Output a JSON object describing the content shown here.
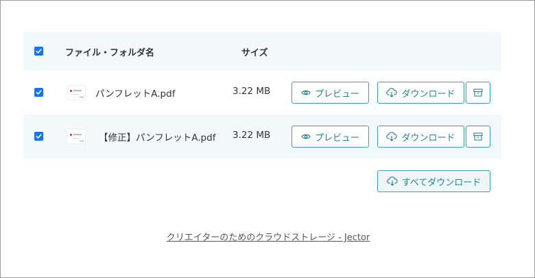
{
  "table": {
    "header": {
      "name_label": "ファイル・フォルダ名",
      "size_label": "サイズ",
      "select_all_checked": true
    },
    "rows": [
      {
        "checked": true,
        "name": "パンフレットA.pdf",
        "size": "3.22 MB",
        "preview_label": "プレビュー",
        "download_label": "ダウンロード"
      },
      {
        "checked": true,
        "name": "【修正】パンフレットA.pdf",
        "size": "3.22 MB",
        "preview_label": "プレビュー",
        "download_label": "ダウンロード"
      }
    ]
  },
  "actions": {
    "download_all_label": "すべてダウンロード"
  },
  "footer": {
    "link_text": "クリエイターのためのクラウドストレージ - Jector"
  },
  "colors": {
    "accent": "#2a8193",
    "checkbox": "#1a73e8",
    "row_highlight": "#f3f8fb"
  },
  "icons": {
    "preview": "eye-icon",
    "download": "cloud-download-icon",
    "archive": "archive-box-icon",
    "check": "check-icon"
  }
}
